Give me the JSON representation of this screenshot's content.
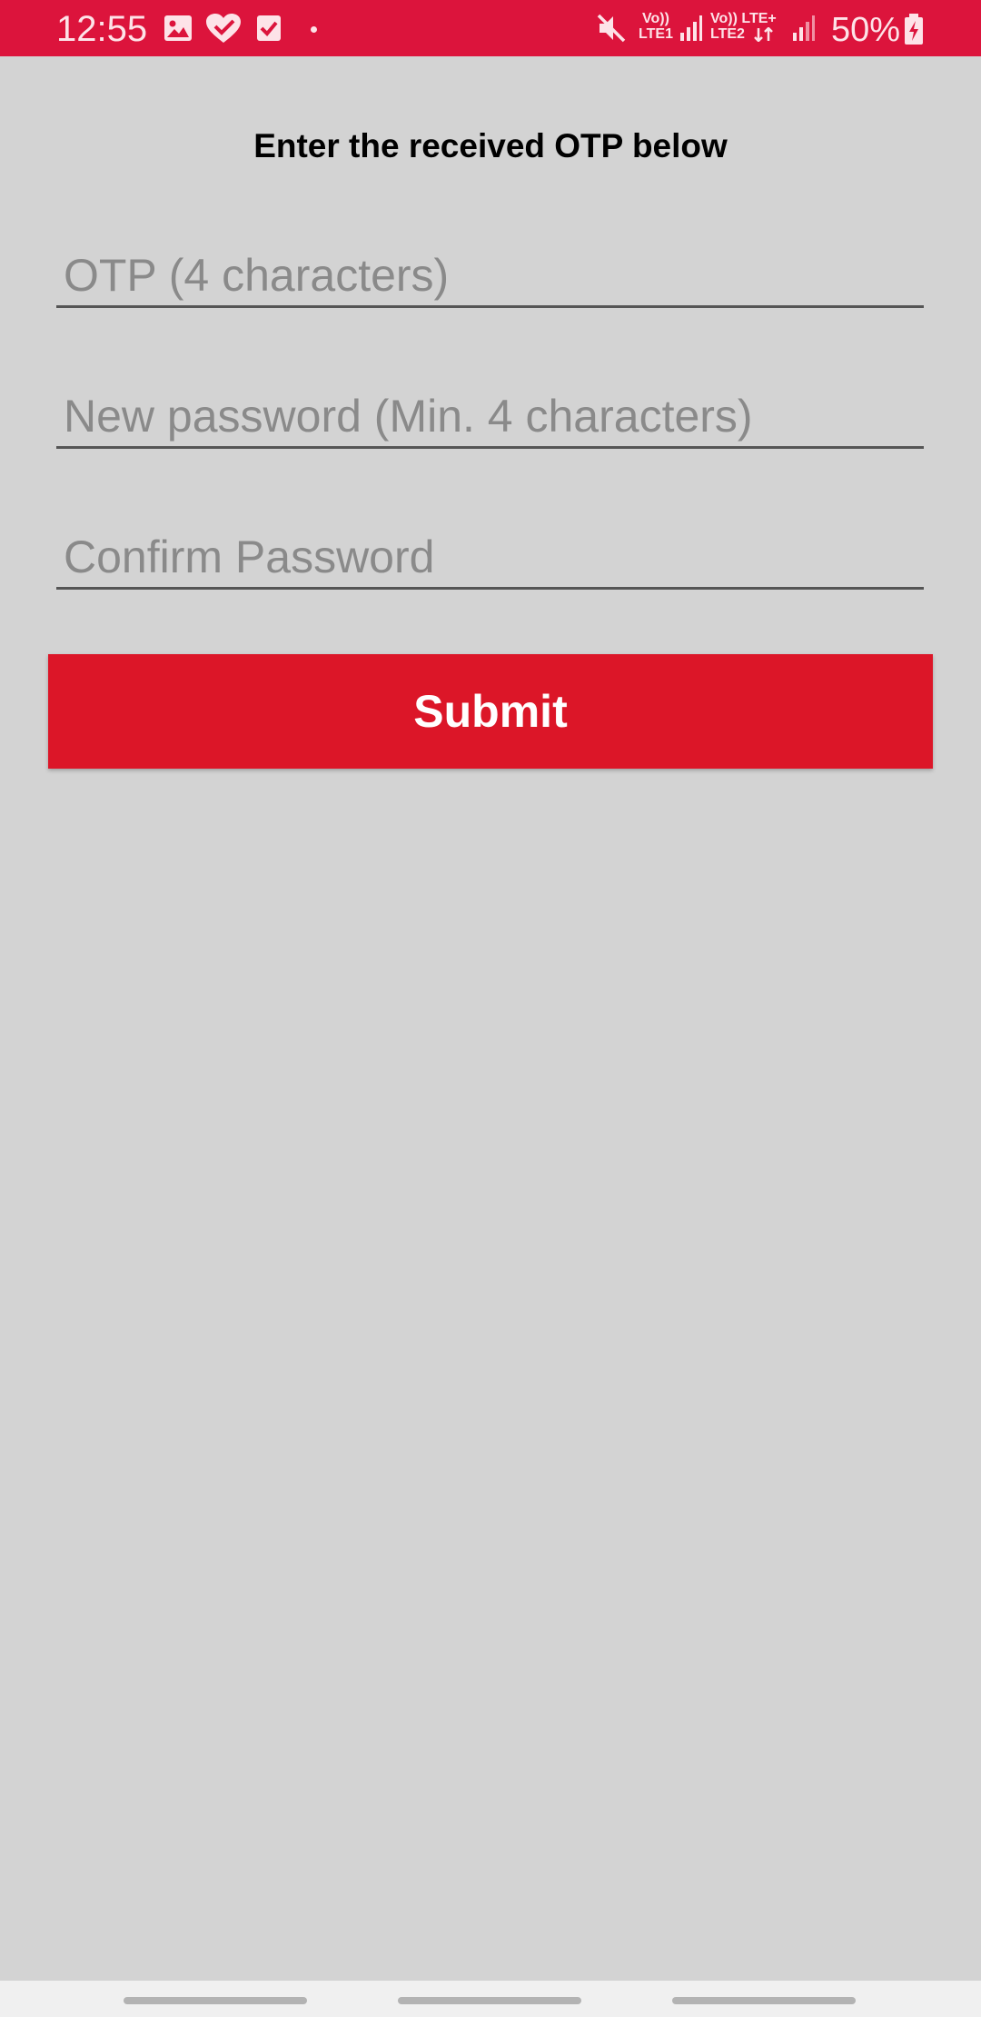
{
  "status_bar": {
    "time": "12:55",
    "sim1_label_top": "Vo))",
    "sim1_label_bottom": "LTE1",
    "sim2_label_top": "Vo)) LTE+",
    "sim2_label_bottom": "LTE2",
    "battery_percent": "50%",
    "icons": [
      "gallery-icon",
      "heart-check-icon",
      "checkbox-icon",
      "notification-dot",
      "mute-icon",
      "signal-icon",
      "signal-icon",
      "battery-charging-icon"
    ],
    "color": "#dc143c"
  },
  "form": {
    "heading": "Enter the received OTP below",
    "otp_placeholder": "OTP (4 characters)",
    "otp_value": "",
    "new_password_placeholder": "New password (Min. 4 characters)",
    "new_password_value": "",
    "confirm_password_placeholder": "Confirm Password",
    "confirm_password_value": "",
    "submit_label": "Submit",
    "submit_color": "#dc1628"
  },
  "nav_bar": {
    "items": [
      "recent-apps",
      "home",
      "back"
    ]
  }
}
